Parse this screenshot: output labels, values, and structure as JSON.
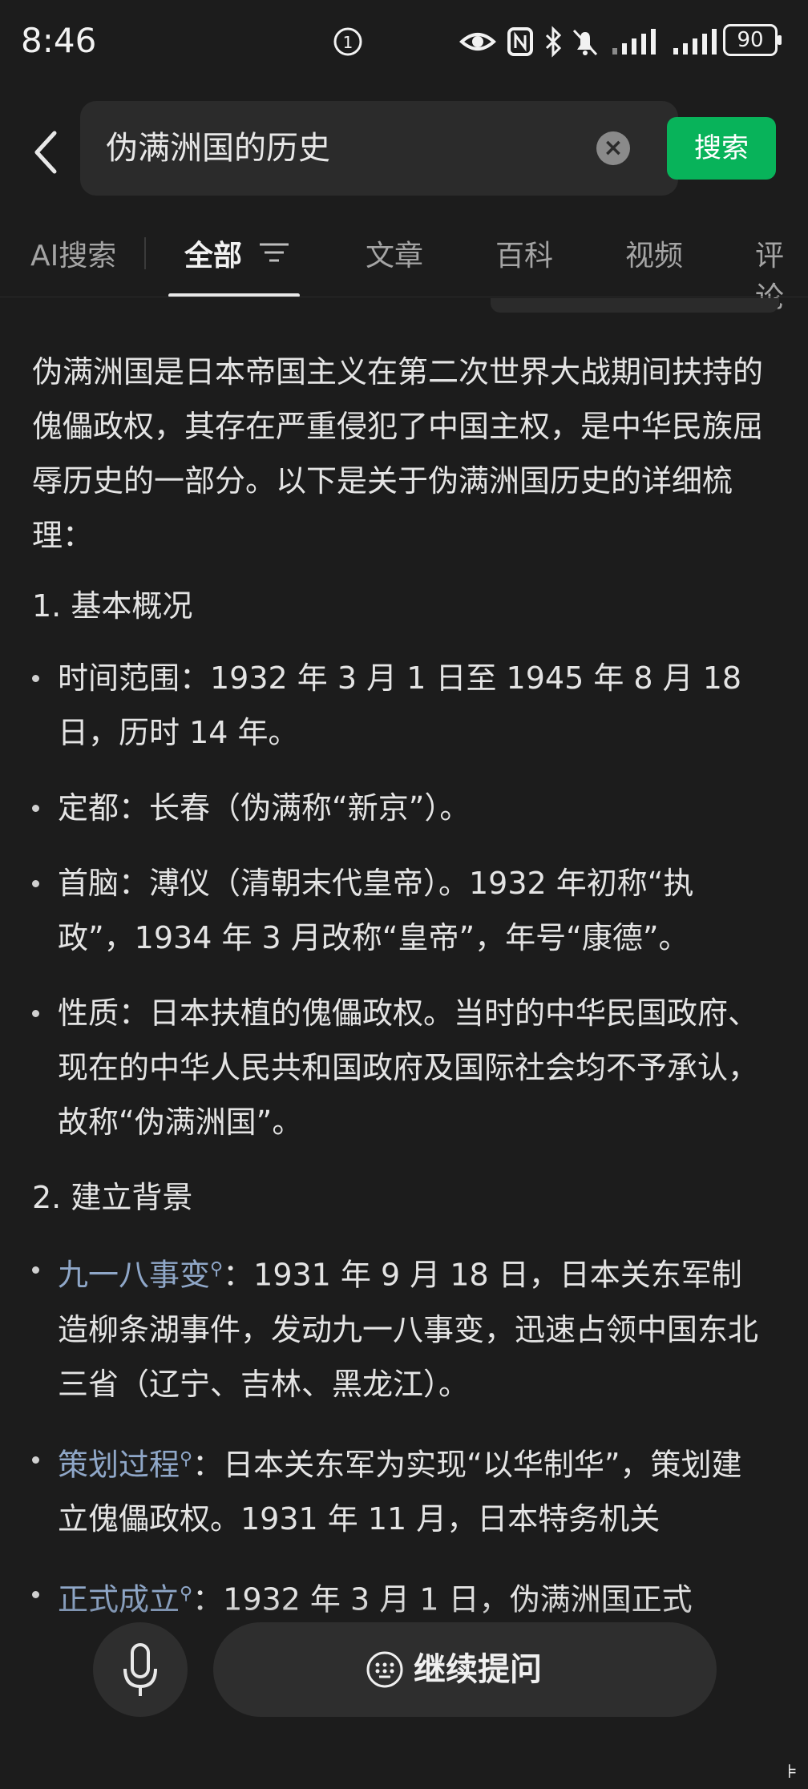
{
  "status_bar": {
    "time": "8:46",
    "battery": "90",
    "notification_badge": "1"
  },
  "search": {
    "query": "伪满洲国的历史",
    "button_label": "搜索"
  },
  "tabs": [
    {
      "label": "AI搜索"
    },
    {
      "label": "全部",
      "active": true
    },
    {
      "label": "文章"
    },
    {
      "label": "百科"
    },
    {
      "label": "视频"
    },
    {
      "label": "评论"
    }
  ],
  "article": {
    "intro": "伪满洲国是日本帝国主义在第二次世界大战期间扶持的傀儡政权，其存在严重侵犯了中国主权，是中华民族屈辱历史的一部分。以下是关于伪满洲国历史的详细梳理：",
    "section1": {
      "heading": "1. 基本概况",
      "items": [
        "时间范围：1932 年 3 月 1 日至 1945 年 8 月 18 日，历时 14 年。",
        "定都：长春（伪满称“新京”）。",
        "首脑：溥仪（清朝末代皇帝）。1932 年初称“执政”，1934 年 3 月改称“皇帝”，年号“康德”。",
        "性质：日本扶植的傀儡政权。当时的中华民国政府、现在的中华人民共和国政府及国际社会均不予承认，故称“伪满洲国”。"
      ]
    },
    "section2": {
      "heading": "2. 建立背景",
      "items": [
        {
          "link": "九一八事变",
          "text": "：1931 年 9 月 18 日，日本关东军制造柳条湖事件，发动九一八事变，迅速占领中国东北三省（辽宁、吉林、黑龙江）。"
        },
        {
          "link": "策划过程",
          "text": "：日本关东军为实现“以华制华”，策划建立傀儡政权。1931 年 11 月，日本特务机关"
        },
        {
          "link": "正式成立",
          "text": "：1932 年 3 月 1 日，伪满洲国正式"
        }
      ]
    }
  },
  "bottom_bar": {
    "ask_label": "继续提问"
  },
  "icons": {
    "back": "chevron-left-icon",
    "clear": "clear-icon",
    "filter": "filter-icon",
    "mic": "mic-icon",
    "keyboard": "keyboard-icon",
    "magnifier": "magnifier-icon"
  },
  "colors": {
    "background": "#1c1c1c",
    "accent_green": "#08b35a",
    "link": "#8fa7c8"
  }
}
